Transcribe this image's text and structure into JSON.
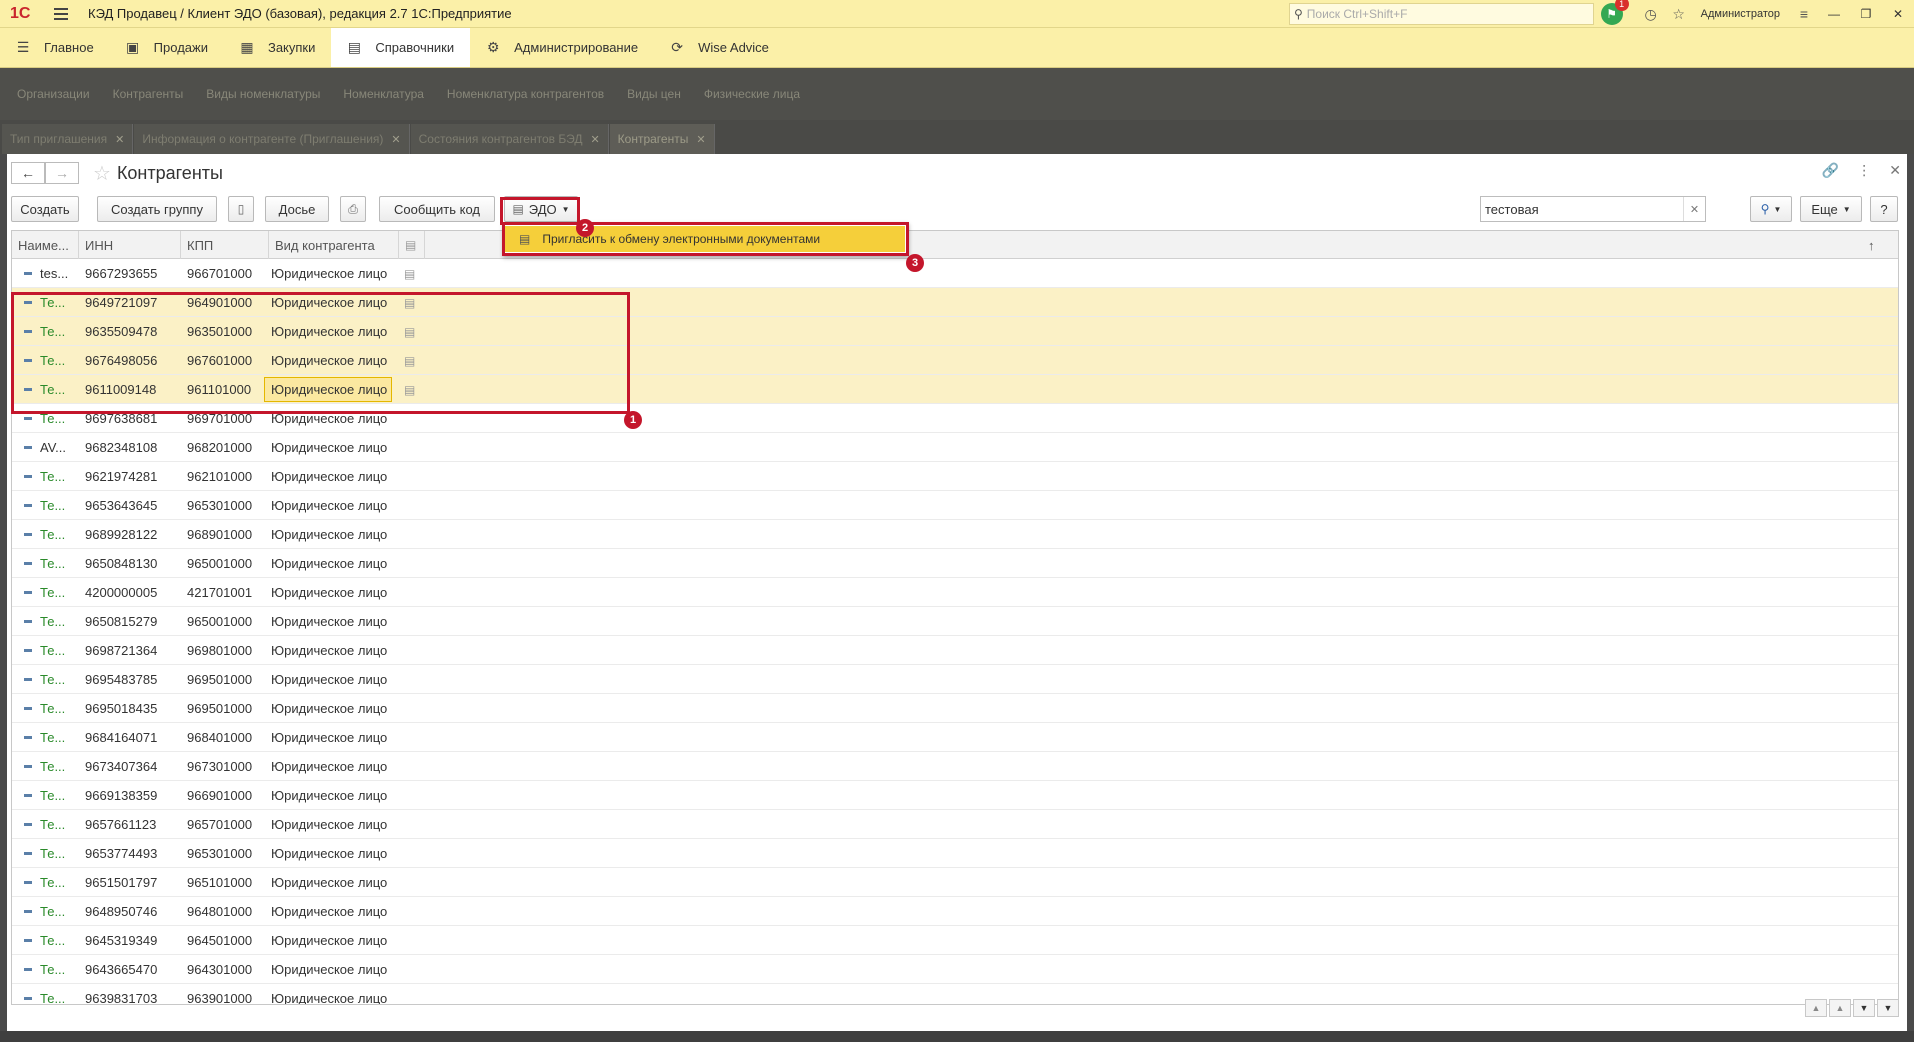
{
  "window": {
    "title": "КЭД Продавец / Клиент ЭДО (базовая), редакция 2.7 1С:Предприятие",
    "search_placeholder": "Поиск Ctrl+Shift+F",
    "notification_count": "1",
    "user": "Администратор",
    "logo": "1С"
  },
  "main_menu": [
    {
      "label": "Главное",
      "icon": "menu-icon"
    },
    {
      "label": "Продажи",
      "icon": "sales-icon"
    },
    {
      "label": "Закупки",
      "icon": "purchases-icon"
    },
    {
      "label": "Справочники",
      "icon": "directory-icon",
      "active": true
    },
    {
      "label": "Администрирование",
      "icon": "gear-icon"
    },
    {
      "label": "Wise Advice",
      "icon": "wise-advice-icon"
    }
  ],
  "section_links": [
    "Организации",
    "Контрагенты",
    "Виды номенклатуры",
    "Номенклатура",
    "Номенклатура контрагентов",
    "Виды цен",
    "Физические лица"
  ],
  "open_tabs": [
    {
      "label": "Тип приглашения",
      "active": false
    },
    {
      "label": "Информация о контрагенте (Приглашения)",
      "active": false
    },
    {
      "label": "Состояния контрагентов БЭД",
      "active": false
    },
    {
      "label": "Контрагенты",
      "active": true
    }
  ],
  "form": {
    "title": "Контрагенты"
  },
  "toolbar": {
    "create": "Создать",
    "create_group": "Создать группу",
    "dossier": "Досье",
    "report_code": "Сообщить код",
    "edo": "ЭДО",
    "search_value": "тестовая",
    "more": "Еще",
    "help": "?"
  },
  "dropdown": {
    "item": "Пригласить к обмену электронными документами"
  },
  "markers": [
    "1",
    "2",
    "3"
  ],
  "table": {
    "columns": [
      "Наиме...",
      "ИНН",
      "КПП",
      "Вид контрагента"
    ],
    "rows": [
      {
        "name": "tes...",
        "inn": "9667293655",
        "kpp": "966701000",
        "kind": "Юридическое лицо",
        "edo": true,
        "selected": false,
        "green": false
      },
      {
        "name": "Те...",
        "inn": "9649721097",
        "kpp": "964901000",
        "kind": "Юридическое лицо",
        "edo": true,
        "selected": true,
        "green": true
      },
      {
        "name": "Те...",
        "inn": "9635509478",
        "kpp": "963501000",
        "kind": "Юридическое лицо",
        "edo": true,
        "selected": true,
        "green": true
      },
      {
        "name": "Те...",
        "inn": "9676498056",
        "kpp": "967601000",
        "kind": "Юридическое лицо",
        "edo": true,
        "selected": true,
        "green": true
      },
      {
        "name": "Те...",
        "inn": "9611009148",
        "kpp": "961101000",
        "kind": "Юридическое лицо",
        "edo": true,
        "selected": true,
        "green": true,
        "focus": true
      },
      {
        "name": "Те...",
        "inn": "9697638681",
        "kpp": "969701000",
        "kind": "Юридическое лицо",
        "green": true
      },
      {
        "name": "AV...",
        "inn": "9682348108",
        "kpp": "968201000",
        "kind": "Юридическое лицо",
        "green": false
      },
      {
        "name": "Те...",
        "inn": "9621974281",
        "kpp": "962101000",
        "kind": "Юридическое лицо",
        "green": true
      },
      {
        "name": "Те...",
        "inn": "9653643645",
        "kpp": "965301000",
        "kind": "Юридическое лицо",
        "green": true
      },
      {
        "name": "Те...",
        "inn": "9689928122",
        "kpp": "968901000",
        "kind": "Юридическое лицо",
        "green": true
      },
      {
        "name": "Те...",
        "inn": "9650848130",
        "kpp": "965001000",
        "kind": "Юридическое лицо",
        "green": true
      },
      {
        "name": "Те...",
        "inn": "4200000005",
        "kpp": "421701001",
        "kind": "Юридическое лицо",
        "green": true
      },
      {
        "name": "Те...",
        "inn": "9650815279",
        "kpp": "965001000",
        "kind": "Юридическое лицо",
        "green": true
      },
      {
        "name": "Те...",
        "inn": "9698721364",
        "kpp": "969801000",
        "kind": "Юридическое лицо",
        "green": true
      },
      {
        "name": "Те...",
        "inn": "9695483785",
        "kpp": "969501000",
        "kind": "Юридическое лицо",
        "green": true
      },
      {
        "name": "Те...",
        "inn": "9695018435",
        "kpp": "969501000",
        "kind": "Юридическое лицо",
        "green": true
      },
      {
        "name": "Те...",
        "inn": "9684164071",
        "kpp": "968401000",
        "kind": "Юридическое лицо",
        "green": true
      },
      {
        "name": "Те...",
        "inn": "9673407364",
        "kpp": "967301000",
        "kind": "Юридическое лицо",
        "green": true
      },
      {
        "name": "Те...",
        "inn": "9669138359",
        "kpp": "966901000",
        "kind": "Юридическое лицо",
        "green": true
      },
      {
        "name": "Те...",
        "inn": "9657661123",
        "kpp": "965701000",
        "kind": "Юридическое лицо",
        "green": true
      },
      {
        "name": "Те...",
        "inn": "9653774493",
        "kpp": "965301000",
        "kind": "Юридическое лицо",
        "green": true
      },
      {
        "name": "Те...",
        "inn": "9651501797",
        "kpp": "965101000",
        "kind": "Юридическое лицо",
        "green": true
      },
      {
        "name": "Те...",
        "inn": "9648950746",
        "kpp": "964801000",
        "kind": "Юридическое лицо",
        "green": true
      },
      {
        "name": "Те...",
        "inn": "9645319349",
        "kpp": "964501000",
        "kind": "Юридическое лицо",
        "green": true
      },
      {
        "name": "Те...",
        "inn": "9643665470",
        "kpp": "964301000",
        "kind": "Юридическое лицо",
        "green": true
      },
      {
        "name": "Те...",
        "inn": "9639831703",
        "kpp": "963901000",
        "kind": "Юридическое лицо",
        "green": true
      }
    ]
  },
  "colors": {
    "accent_yellow": "#fbf0a8",
    "highlight": "#f5cf3a",
    "annotation_red": "#c4162b",
    "name_green": "#2a8a2a"
  }
}
